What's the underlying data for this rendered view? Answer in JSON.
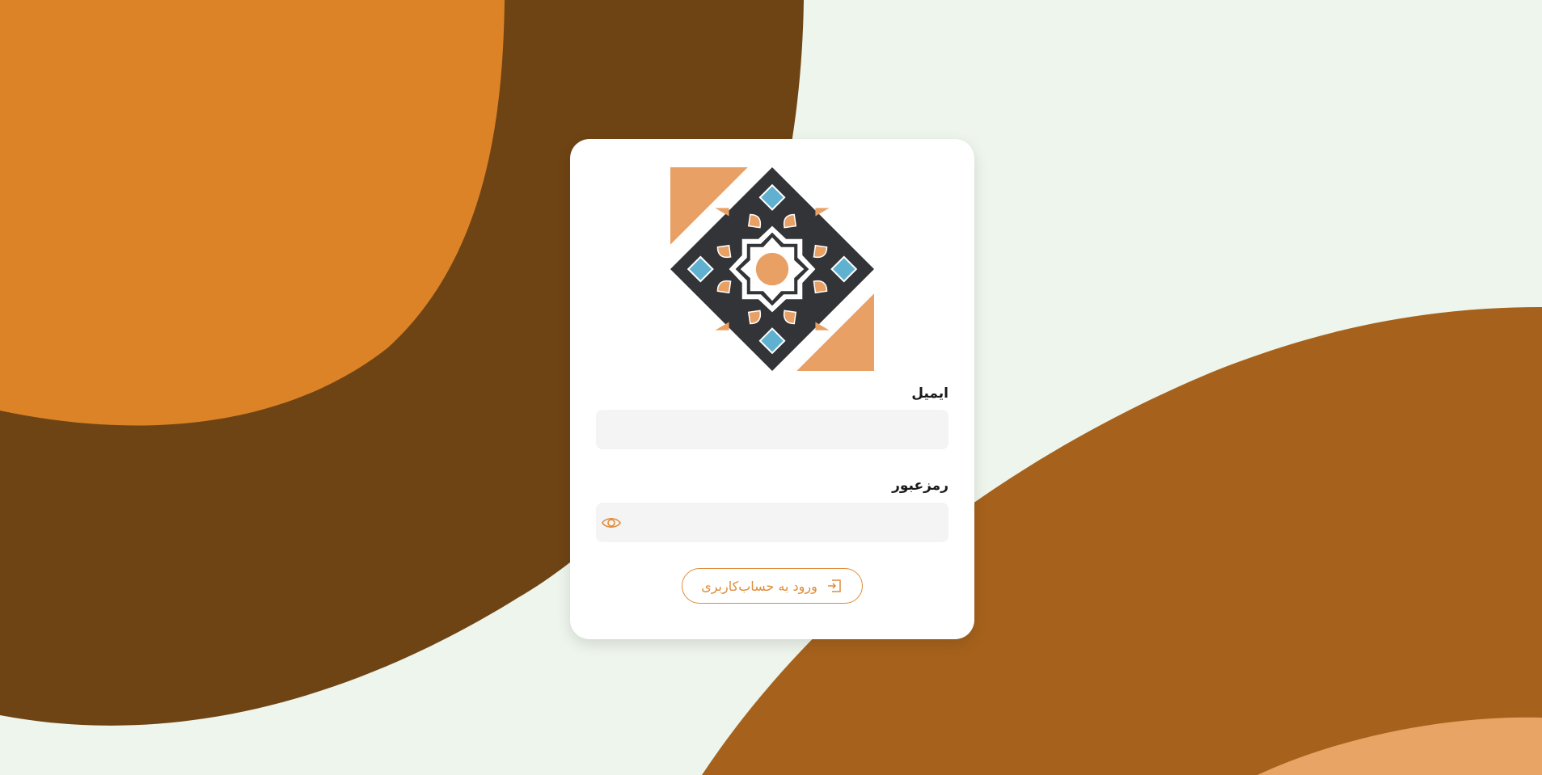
{
  "background": {
    "base_color": "#edf5ec",
    "colors": [
      "#dc8328",
      "#6f4414",
      "#a6621c",
      "#e8a464"
    ]
  },
  "logo": {
    "icon": "geometric-tile-logo-icon",
    "colors": {
      "dark": "#333437",
      "orange": "#e8a065",
      "blue": "#5fb1cf",
      "white": "#ffffff"
    }
  },
  "form": {
    "email_label": "ایمیل",
    "email_value": "",
    "email_placeholder": "",
    "password_label": "رمزعبور",
    "password_value": "",
    "password_placeholder": "",
    "password_toggle_icon": "eye-icon"
  },
  "login_button": {
    "label": "ورود به حساب‌کاربری",
    "icon": "login-icon",
    "color": "#df8c3a"
  }
}
